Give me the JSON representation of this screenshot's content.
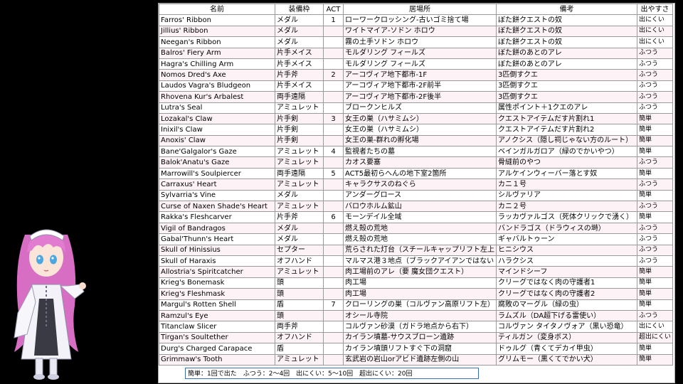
{
  "headers": {
    "name": "名前",
    "slot": "装備枠",
    "act": "ACT",
    "location": "居場所",
    "note": "備考",
    "ease": "出やすさ"
  },
  "rows": [
    {
      "name": "Farros' Ribbon",
      "slot": "メダル",
      "act": "1",
      "location": "ローワークロッシング-古いゴミ捨て場",
      "note": "ぼた餅クエストの奴",
      "ease": "出にくい"
    },
    {
      "name": "Jillius' Ribbon",
      "slot": "メダル",
      "act": "",
      "location": "ワイトマイア-ソドン ホロウ",
      "note": "ぼた餅クエストの奴",
      "ease": "出にくい"
    },
    {
      "name": "Neegan's Ribbon",
      "slot": "メダル",
      "act": "",
      "location": "霧の土手ソドン ホロウ",
      "note": "ぼた餅クエストの奴",
      "ease": "出にくい"
    },
    {
      "name": "Balros' Fiery Arm",
      "slot": "片手メイス",
      "act": "",
      "location": "モルダリング フィールズ",
      "note": "ぼた餅のあとのアレ",
      "ease": "ふつう"
    },
    {
      "name": "Hagra's Chilling Arm",
      "slot": "片手メイス",
      "act": "",
      "location": "モルダリング フィールズ",
      "note": "ぼた餅のあとのアレ",
      "ease": "ふつう"
    },
    {
      "name": "Nomos Dred's Axe",
      "slot": "片手斧",
      "act": "2",
      "location": "アーコヴィア地下都市-1F",
      "note": "3匹倒すクエ",
      "ease": "ふつう"
    },
    {
      "name": "Laudos Vagra's Bludgeon",
      "slot": "片手メイス",
      "act": "",
      "location": "アーコヴィア地下都市-2F前半",
      "note": "3匹倒すクエ",
      "ease": "ふつう"
    },
    {
      "name": "Rhovena Kur's Arbalest",
      "slot": "両手遠隔",
      "act": "",
      "location": "アーコヴィア地下都市-2F後半",
      "note": "3匹倒すクエ",
      "ease": "ふつう"
    },
    {
      "name": "Lutra's Seal",
      "slot": "アミュレット",
      "act": "",
      "location": "ブロークンヒルズ",
      "note": "属性ポイント＋1クエのアレ",
      "ease": "ふつう"
    },
    {
      "name": "Lozakal's Claw",
      "slot": "片手剣",
      "act": "3",
      "location": "女王の巣（ハサミムシ）",
      "note": "クエストアイテムだす片割れ1",
      "ease": "簡単"
    },
    {
      "name": "Inixil's Claw",
      "slot": "片手剣",
      "act": "",
      "location": "女王の巣（ハサミムシ）",
      "note": "クエストアイテムだす片割れ2",
      "ease": "簡単"
    },
    {
      "name": "Anoxis' Claw",
      "slot": "片手剣",
      "act": "",
      "location": "女王の巣-群れの孵化場",
      "note": "アノクシス（隠し祠じゃない方のルート）",
      "ease": "簡単"
    },
    {
      "name": "Bane'Galgalor's Gaze",
      "slot": "アミュレット",
      "act": "4",
      "location": "監視者たちの墓",
      "note": "ベインガルガロア（緑のでかいやつ）",
      "ease": "簡単"
    },
    {
      "name": "Balok'Anatu's Gaze",
      "slot": "アミュレット",
      "act": "",
      "location": "カオス要塞",
      "note": "骨縫前のやつ",
      "ease": "ふつう"
    },
    {
      "name": "Marrowill's Soulpiercer",
      "slot": "両手遠隔",
      "act": "5",
      "location": "ACT5最初らへんの地下室2箇所",
      "note": "アルケインウィーバー落とす奴",
      "ease": "簡単"
    },
    {
      "name": "Carraxus' Heart",
      "slot": "アミュレット",
      "act": "",
      "location": "キャラクサスのねぐら",
      "note": "カニ１号",
      "ease": "ふつう"
    },
    {
      "name": "Sylvarria's Vine",
      "slot": "メダル",
      "act": "",
      "location": "アンダーグロース",
      "note": "シルヴァリア",
      "ease": "簡単"
    },
    {
      "name": "Curse of Naxen Shade's Heart",
      "slot": "アミュレット",
      "act": "",
      "location": "バロウホルム鉱山",
      "note": "カニ２号",
      "ease": "ふつう"
    },
    {
      "name": "Rakka's Fleshcarver",
      "slot": "片手斧",
      "act": "6",
      "location": "モーンデイル全域",
      "note": "ラッカヴァルゴス（死体クリックで湧く）",
      "ease": "簡単"
    },
    {
      "name": "Vigil of Bandragos",
      "slot": "メダル",
      "act": "",
      "location": "燃え殻の荒地",
      "note": "バンドラゴス（ドラウィスの塒）",
      "ease": "ふつう"
    },
    {
      "name": "Gabal'Thunn's Heart",
      "slot": "メダル",
      "act": "",
      "location": "燃え殻の荒地",
      "note": "ギャバルトゥーン",
      "ease": "ふつう"
    },
    {
      "name": "Skull of Hinissius",
      "slot": "セプター",
      "act": "",
      "location": "荒らされた灯台（スチールキャップリフト左上",
      "note": "ヒニシウス",
      "ease": "ふつう"
    },
    {
      "name": "Skull of Haraxis",
      "slot": "オフハンド",
      "act": "",
      "location": "マルマス港３地点（ブラックアイアンではない",
      "note": "ハラクシス",
      "ease": "ふつう"
    },
    {
      "name": "Allostria's Spiritcatcher",
      "slot": "アミュレット",
      "act": "",
      "location": "肉工場前のアレ（要 魔女団クエスト）",
      "note": "マインドシーフ",
      "ease": "簡単"
    },
    {
      "name": "Krieg's Bonemask",
      "slot": "頭",
      "act": "",
      "location": "肉工場",
      "note": "クリーグではなく肉の守護者1",
      "ease": "簡単"
    },
    {
      "name": "Krieg's Fleshmask",
      "slot": "頭",
      "act": "",
      "location": "肉工場",
      "note": "クリーグではなく肉の守護者2",
      "ease": "簡単"
    },
    {
      "name": "Margul's Rotten Shell",
      "slot": "盾",
      "act": "7",
      "location": "クローリングの巣（コルヴァン高原リフト左）",
      "note": "腐敗のマーグル（緑の虫）",
      "ease": "簡単"
    },
    {
      "name": "Ramzul's Eye",
      "slot": "頭",
      "act": "",
      "location": "オシール寺院",
      "note": "ラムズル（DA超下げる雷使い）",
      "ease": "ふつう"
    },
    {
      "name": "Titanclaw Slicer",
      "slot": "両手斧",
      "act": "",
      "location": "コルヴァン砂漠（ガドラ地点から右下）",
      "note": "コルヴァン タイタノヴォア（黒い恐竜）",
      "ease": "出にくい"
    },
    {
      "name": "Tirgan's Soultether",
      "slot": "オフハンド",
      "act": "",
      "location": "カイラン墳墓-サウスブローン遺跡",
      "note": "ティルガン（変身ボス）",
      "ease": "超出にくい"
    },
    {
      "name": "Durg's Charged Carapace",
      "slot": "盾",
      "act": "",
      "location": "カイラン墳頭リフトすぐ下の洞窟",
      "note": "ドゥルグ（青くてデカイ甲虫）",
      "ease": "簡単"
    },
    {
      "name": "Grimmaw's Tooth",
      "slot": "アミュレット",
      "act": "",
      "location": "玄武岩の岩山orアビド遺跡左側の山",
      "note": "グリムモー（黒くてでかい犬）",
      "ease": "簡単"
    }
  ],
  "legend": "簡単：1回で出た　ふつう：2～4回　出にくい：5～10回　超出にくい：20回",
  "colors": {
    "background": "#000000",
    "sheet": "#ffffff",
    "row_alt": "#fdf3f6",
    "legend_border": "#3b6db5"
  },
  "icons": {
    "mascot": "pink-haired-anime-girl"
  }
}
